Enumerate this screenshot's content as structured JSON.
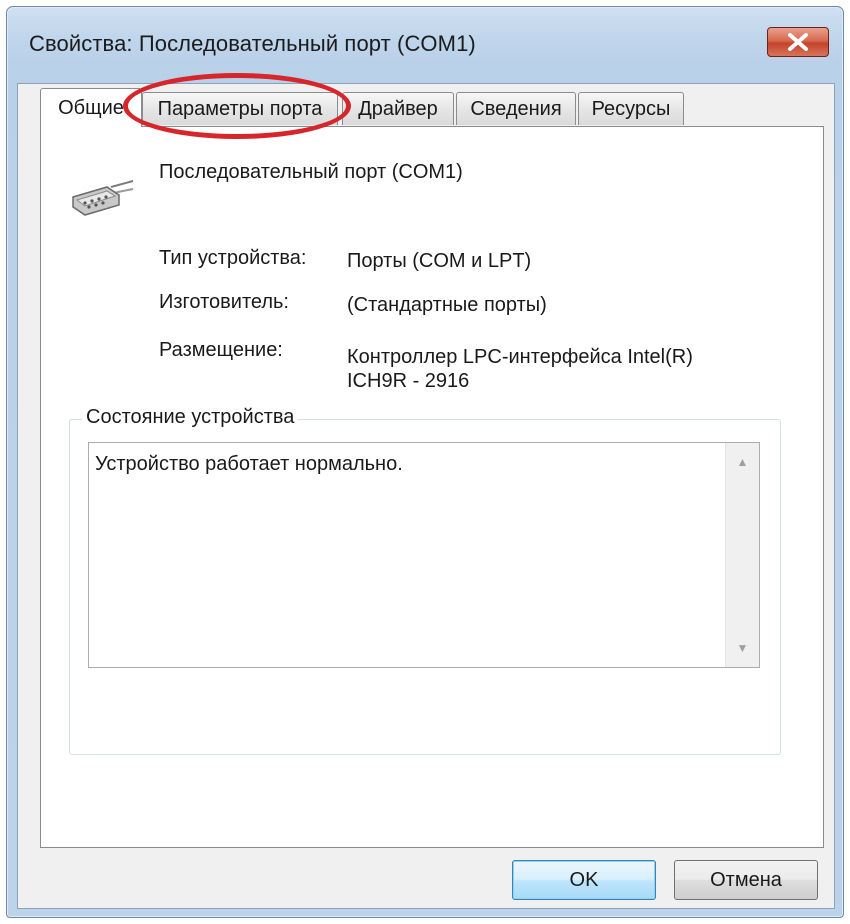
{
  "window": {
    "title": "Свойства: Последовательный порт (COM1)",
    "close_icon": "close-icon"
  },
  "tabs": [
    {
      "label": "Общие",
      "active": true
    },
    {
      "label": "Параметры порта",
      "active": false,
      "highlighted": true
    },
    {
      "label": "Драйвер",
      "active": false
    },
    {
      "label": "Сведения",
      "active": false
    },
    {
      "label": "Ресурсы",
      "active": false
    }
  ],
  "general": {
    "device_icon": "serial-port-icon",
    "device_name": "Последовательный порт (COM1)",
    "properties": [
      {
        "label": "Тип устройства:",
        "value": "Порты (COM и LPT)"
      },
      {
        "label": "Изготовитель:",
        "value": "(Стандартные порты)"
      },
      {
        "label": "Размещение:",
        "value_line1": "Контроллер LPC-интерфейса Intel(R)",
        "value_line2": "ICH9R - 2916"
      }
    ],
    "status_group": {
      "title": "Состояние устройства",
      "text": "Устройство работает нормально."
    }
  },
  "buttons": {
    "ok": "OK",
    "cancel": "Отмена"
  },
  "colors": {
    "highlight_ellipse": "#d6262b",
    "close_button": "#c2432a",
    "title_bar": "#bcd3ea"
  }
}
